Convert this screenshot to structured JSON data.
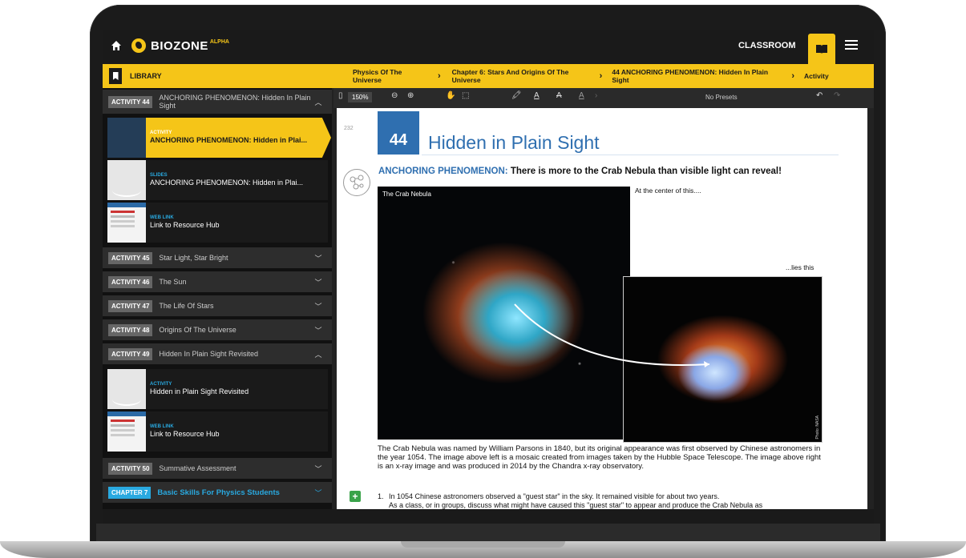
{
  "app": {
    "logo_text": "BIOZONE",
    "logo_badge": "ALPHA",
    "classroom_label": "CLASSROOM"
  },
  "breadcrumb": {
    "library_label": "LIBRARY",
    "items": [
      "Physics Of The Universe",
      "Chapter 6: Stars And Origins Of The Universe",
      "44 ANCHORING PHENOMENON: Hidden In Plain Sight",
      "Activity"
    ]
  },
  "sidebar": {
    "open_activity": {
      "badge": "ACTIVITY 44",
      "title": "ANCHORING PHENOMENON: Hidden In Plain Sight"
    },
    "resources_44": [
      {
        "kind": "ACTIVITY",
        "title": "ANCHORING PHENOMENON: Hidden in Plai..."
      },
      {
        "kind": "SLIDES",
        "title": "ANCHORING PHENOMENON: Hidden in Plai..."
      },
      {
        "kind": "WEB LINK",
        "title": "Link to Resource Hub"
      }
    ],
    "activities": [
      {
        "badge": "ACTIVITY 45",
        "title": "Star Light, Star Bright"
      },
      {
        "badge": "ACTIVITY 46",
        "title": "The Sun"
      },
      {
        "badge": "ACTIVITY 47",
        "title": "The Life Of Stars"
      },
      {
        "badge": "ACTIVITY 48",
        "title": "Origins Of The Universe"
      },
      {
        "badge": "ACTIVITY 49",
        "title": "Hidden In Plain Sight Revisited"
      }
    ],
    "resources_49": [
      {
        "kind": "ACTIVITY",
        "title": "Hidden in Plain Sight Revisited"
      },
      {
        "kind": "WEB LINK",
        "title": "Link to Resource Hub"
      }
    ],
    "activity_50": {
      "badge": "ACTIVITY 50",
      "title": "Summative Assessment"
    },
    "chapter_7": {
      "badge": "CHAPTER 7",
      "title": "Basic Skills For Physics Students"
    }
  },
  "toolbar": {
    "zoom": "150%",
    "presets": "No Presets"
  },
  "document": {
    "page_number": "232",
    "activity_number": "44",
    "activity_title": "Hidden in Plain Sight",
    "anchor_label": "ANCHORING PHENOMENON:",
    "anchor_text": "There is more to the Crab Nebula than visible light can reveal!",
    "image_caption": "The Crab Nebula",
    "photo_credit": "Photo: NASA",
    "at_center": "At the center of this....",
    "lies_this": "...lies this",
    "body": "The Crab Nebula was named by William Parsons in 1840, but its original appearance was first observed by Chinese astronomers in the year 1054. The image above left is a mosaic created from images taken by the Hubble Space Telescope. The image above right is an x-ray image and was produced in 2014 by the Chandra x-ray observatory.",
    "question_number": "1.",
    "question_text": "In 1054 Chinese astronomers observed a \"guest star\" in the sky. It remained visible for about two years.",
    "question_text_2": "As a class, or in groups, discuss what might have caused this \"guest star\" to appear and produce the Crab Nebula as"
  },
  "colors": {
    "accent": "#f5c518",
    "activity_blue": "#2f6fb0",
    "chapter_blue": "#29a9e0",
    "plus_green": "#3aa34a"
  }
}
